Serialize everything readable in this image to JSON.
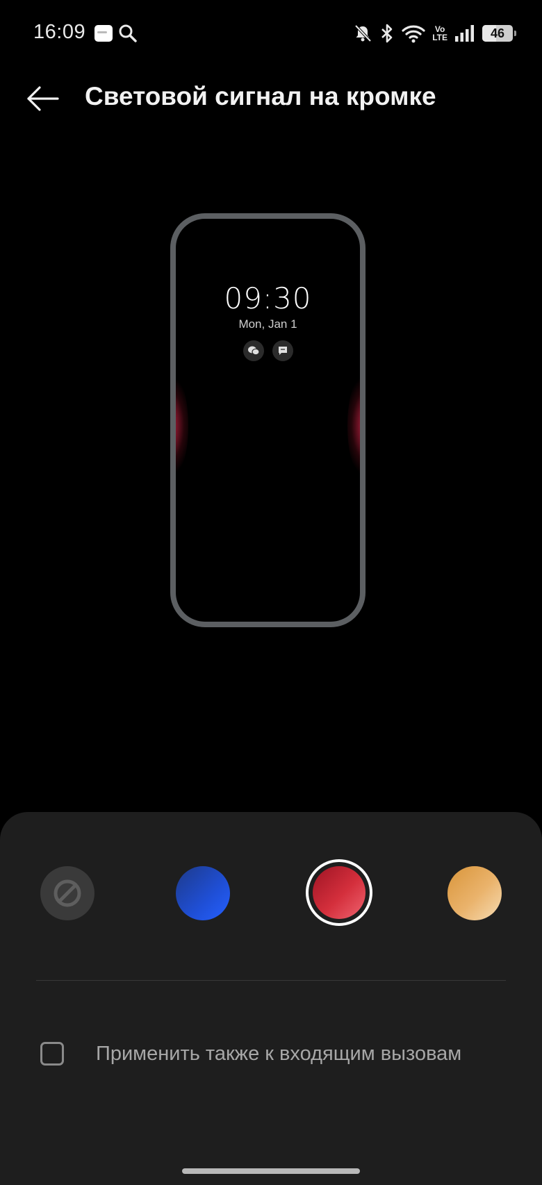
{
  "status_bar": {
    "time": "16:09",
    "battery_level": "46",
    "network": {
      "volte_top": "Vo",
      "volte_bottom": "LTE"
    }
  },
  "header": {
    "title": "Световой сигнал на кромке"
  },
  "preview": {
    "time": "09:30",
    "date": "Mon, Jan 1"
  },
  "colors": {
    "options": [
      {
        "name": "none",
        "icon": "block-icon",
        "selected": false
      },
      {
        "name": "blue",
        "color": "#1f4fd6",
        "selected": false
      },
      {
        "name": "red",
        "color": "#d42f3c",
        "selected": true
      },
      {
        "name": "gold",
        "color": "#eab36c",
        "selected": false
      }
    ],
    "glow_color": "#ff5f7a"
  },
  "options": {
    "apply_to_calls_label": "Применить также к входящим вызовам",
    "apply_to_calls_checked": false
  }
}
